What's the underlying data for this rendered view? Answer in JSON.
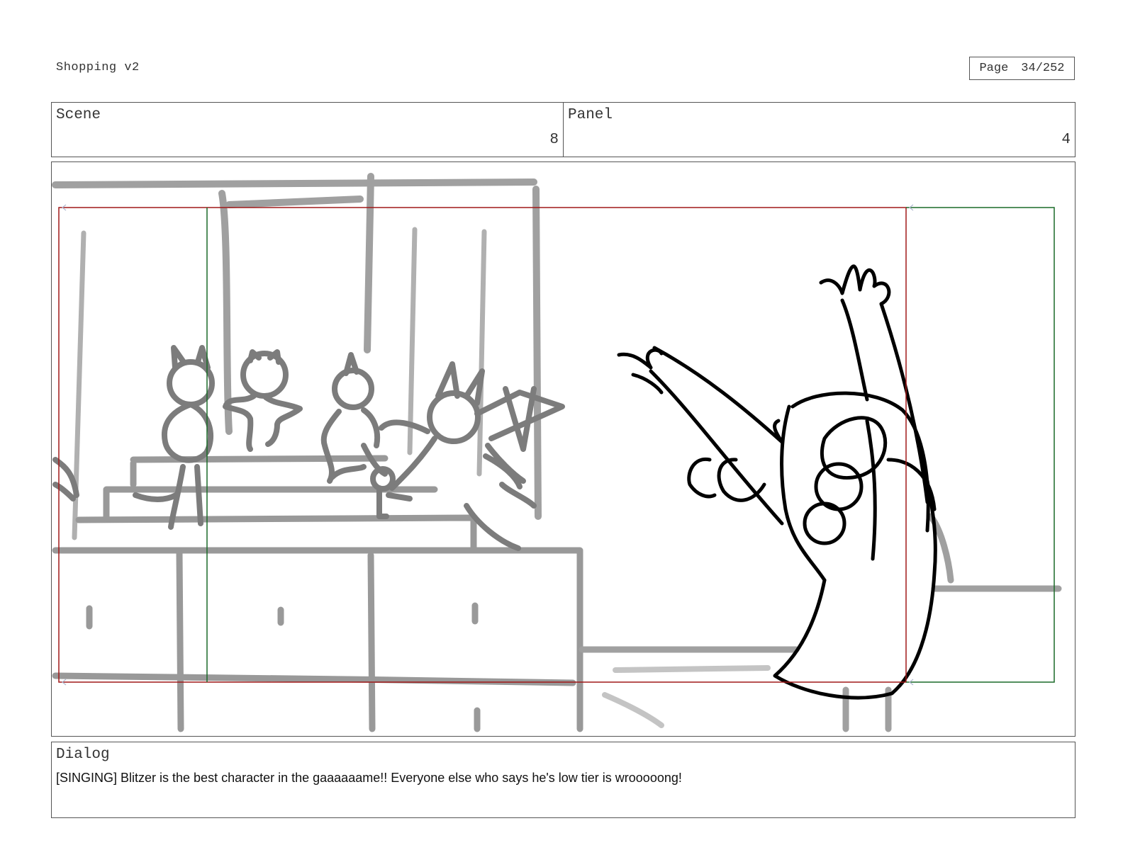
{
  "header": {
    "document_title": "Shopping v2",
    "page_label": "Page",
    "page_number": "34/252"
  },
  "scene": {
    "label": "Scene",
    "value": "8"
  },
  "panel": {
    "label": "Panel",
    "value": "4"
  },
  "dialog": {
    "label": "Dialog",
    "text": "[SINGING] Blitzer is the best character in the gaaaaaame!! Everyone else who says he's low tier is wrooooong!"
  },
  "colors": {
    "frame_border": "#555555",
    "safe_area_red": "#a01818",
    "safe_area_green": "#1a6a28",
    "sketch_gray": "#9a9a9a",
    "sketch_black": "#000000"
  }
}
